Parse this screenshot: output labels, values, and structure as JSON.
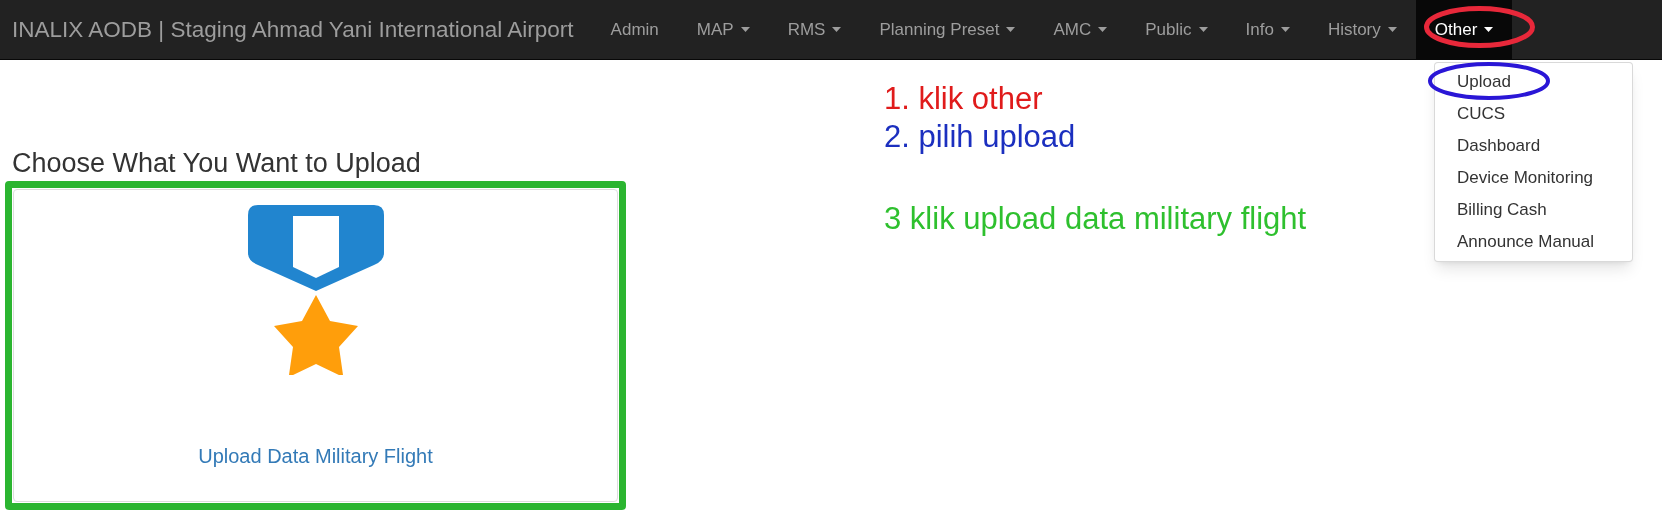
{
  "navbar": {
    "brand": "INALIX AODB | Staging Ahmad Yani International Airport",
    "items": [
      {
        "label": "Admin",
        "dropdown": false,
        "selected": false
      },
      {
        "label": "MAP",
        "dropdown": true,
        "selected": false
      },
      {
        "label": "RMS",
        "dropdown": true,
        "selected": false
      },
      {
        "label": "Planning Preset",
        "dropdown": true,
        "selected": false
      },
      {
        "label": "AMC",
        "dropdown": true,
        "selected": false
      },
      {
        "label": "Public",
        "dropdown": true,
        "selected": false
      },
      {
        "label": "Info",
        "dropdown": true,
        "selected": false
      },
      {
        "label": "History",
        "dropdown": true,
        "selected": false
      },
      {
        "label": "Other",
        "dropdown": true,
        "selected": true
      }
    ]
  },
  "dropdown_menu": {
    "items": [
      "Upload",
      "CUCS",
      "Dashboard",
      "Device Monitoring",
      "Billing Cash",
      "Announce Manual"
    ]
  },
  "page": {
    "heading": "Choose What You Want to Upload",
    "card": {
      "link": "Upload Data Military Flight"
    }
  },
  "annotations": [
    {
      "text": "1. klik other",
      "color": "#e01b1b"
    },
    {
      "text": "2. pilih upload",
      "color": "#1b2fbf"
    },
    {
      "text": "3 klik upload data military flight",
      "color": "#2ec02e"
    }
  ]
}
